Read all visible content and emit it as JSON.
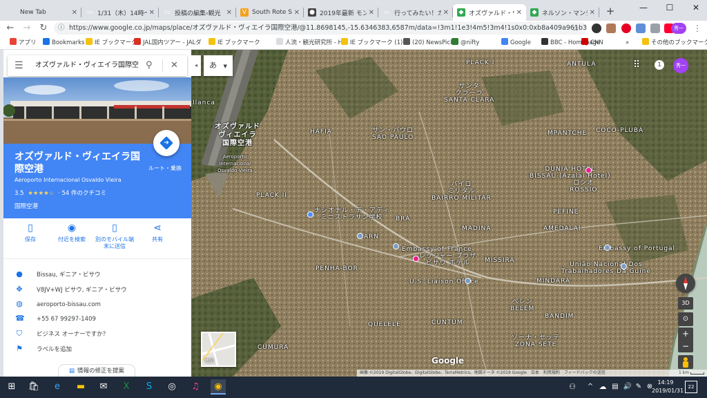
{
  "browser": {
    "tabs": [
      {
        "title": "New Tab",
        "fav": "",
        "fav_color": "#dee1e6"
      },
      {
        "title": "1/31（木）14時～",
        "fav": "▭",
        "fav_color": "#dee1e6"
      },
      {
        "title": "投稿の編集‹観光",
        "fav": "▭",
        "fav_color": "#dee1e6"
      },
      {
        "title": "South Rote Sao To",
        "fav": "V",
        "fav_color": "#f4a21e"
      },
      {
        "title": "2019年最新 モンロ",
        "fav": "●",
        "fav_color": "#444444"
      },
      {
        "title": "行ってみたい！カー",
        "fav": "▭",
        "fav_color": "#dee1e6"
      },
      {
        "title": "オズヴァルド・ヴィエ",
        "fav": "◆",
        "fav_color": "#34a853",
        "active": true
      },
      {
        "title": "ネルソン・マンデラ国",
        "fav": "◆",
        "fav_color": "#34a853"
      }
    ],
    "new_tab": "+",
    "url": "https://www.google.co.jp/maps/place/オズヴァルド・ヴィエイラ国際空港/@11.8698145,-15.6346383,6587m/data=!3m1!1e3!4m5!3m4!1s0x0:0xb8a409a961b3ffd4!8m2!3d11.88227...",
    "bookmarks": [
      {
        "label": "アプリ",
        "icon_color": "#ea4335"
      },
      {
        "label": "Bookmarks",
        "icon_color": "#1a73e8"
      },
      {
        "label": "IE ブックマーク",
        "icon_color": "#f4c20d"
      },
      {
        "label": "JAL国内ツアー - JALダ",
        "icon_color": "#d93025"
      },
      {
        "label": "IE ブックマーク",
        "icon_color": "#f4c20d"
      },
      {
        "label": "人流・観光研究所 - H",
        "icon_color": "#dadce0"
      },
      {
        "label": "IE ブックマーク (1)",
        "icon_color": "#f4c20d"
      },
      {
        "label": "(20) NewsPicks",
        "icon_color": "#555555"
      },
      {
        "label": "@nifty",
        "icon_color": "#2e7d32"
      },
      {
        "label": "Google",
        "icon_color": "#4285f4"
      },
      {
        "label": "BBC - Homepage",
        "icon_color": "#333333"
      },
      {
        "label": "CNN",
        "icon_color": "#cc0000"
      },
      {
        "label": "»",
        "icon_color": ""
      },
      {
        "label": "その他のブックマーク",
        "icon_color": "#f4c20d"
      }
    ],
    "profile_initial": "秀一"
  },
  "panel": {
    "search_value": "オズヴァルド・ヴィエイラ国際空",
    "place_name": "オズヴァルド・ヴィエイラ国際空港",
    "place_name_en": "Aeroporto Internacional Osvaldo Vieira",
    "rating": "3.5",
    "stars": "★★★★☆",
    "reviews": "· 54 件のクチコミ",
    "category": "国際空港",
    "route_label": "ルート・乗換",
    "actions": [
      {
        "label": "保存",
        "icon": "bookmark-icon",
        "glyph": "▯"
      },
      {
        "label": "付近を検索",
        "icon": "nearby-icon",
        "glyph": "◉"
      },
      {
        "label": "別のモバイル端末に送信",
        "icon": "send-to-phone-icon",
        "glyph": "▯"
      },
      {
        "label": "共有",
        "icon": "share-icon",
        "glyph": "⋖"
      }
    ],
    "info": [
      {
        "text": "Bissau, ギニア・ビサウ",
        "icon": "location-pin-icon",
        "glyph": "●"
      },
      {
        "text": "V8JV+WJ ビサウ, ギニア・ビサウ",
        "icon": "plus-code-icon",
        "glyph": "✥"
      },
      {
        "text": "aeroporto-bissau.com",
        "icon": "globe-icon",
        "glyph": "◍"
      },
      {
        "text": "+55 67 99297-1409",
        "icon": "phone-icon",
        "glyph": "☎"
      },
      {
        "text": "ビジネス オーナーですか？",
        "icon": "shield-icon",
        "glyph": "⛉"
      },
      {
        "text": "ラベルを追加",
        "icon": "flag-icon",
        "glyph": "⚑"
      }
    ],
    "suggest_edit": "情報の修正を提案"
  },
  "map": {
    "language_button": "あ",
    "notification_count": "1",
    "labels": [
      {
        "text": "PLACK I"
      },
      {
        "text": "ANTULA"
      },
      {
        "text": "サンタ\nクラーラ\nSANTA CLARA"
      },
      {
        "text": "オズヴァルド\nヴィエイラ\n国際空港"
      },
      {
        "text": "Aeroporto\nInternacional\nOsvaldo Vieira"
      },
      {
        "text": "HAFIA"
      },
      {
        "text": "サン・パウロ\nSAO PAULO"
      },
      {
        "text": "MPANTCHE"
      },
      {
        "text": "COCO-PLUBÁ"
      },
      {
        "text": "DUNIA HOTEL\nBISSAU (Azalai Hotel)"
      },
      {
        "text": "ロシオ\nROSSIO"
      },
      {
        "text": "PLACK II"
      },
      {
        "text": "バイロ\nミリタル\nBAIRRO MILITAR"
      },
      {
        "text": "PEFINE"
      },
      {
        "text": "ナシオナル・デ・アディ\nミニストラサン学校"
      },
      {
        "text": "BRÁ"
      },
      {
        "text": "MADINA"
      },
      {
        "text": "AMEDALAI"
      },
      {
        "text": "ARN"
      },
      {
        "text": "Embassy of France"
      },
      {
        "text": "Embassy of Portugal"
      },
      {
        "text": "レッジャー プラザ\nビサウ ホテル"
      },
      {
        "text": "MISSIRA"
      },
      {
        "text": "União Nacional Dos\nTrabalhadores Da Guiné"
      },
      {
        "text": "PENHA-BOR"
      },
      {
        "text": "U.S. Liaison Office"
      },
      {
        "text": "MINDARÁ"
      },
      {
        "text": "ベレン\nBELEM"
      },
      {
        "text": "BANDIM"
      },
      {
        "text": "QUELELE"
      },
      {
        "text": "CUNTUM"
      },
      {
        "text": "ゾーナ・セッテ\nZONA SETE"
      },
      {
        "text": "CUMURA"
      },
      {
        "text": "Ilanca"
      }
    ],
    "minimap_label": "地図",
    "google_logo": "Google",
    "attribution": "画像 ©2019 DigitalGlobe、DigitalGlobe、TerraMetrics、地図データ ©2019 Google　日本　利用規約　フィードバックの送信",
    "scale": "1 km",
    "btn_3d": "3D"
  },
  "taskbar": {
    "time": "14:19",
    "date": "2019/01/31",
    "notifications": "22"
  }
}
